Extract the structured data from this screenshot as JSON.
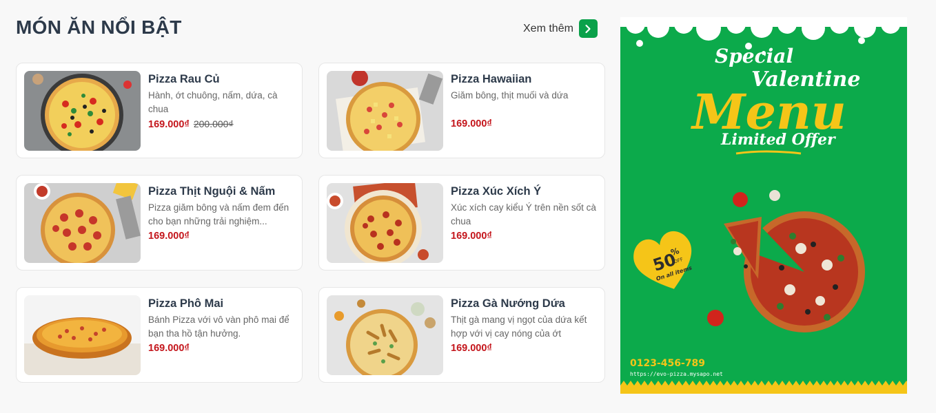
{
  "section": {
    "title": "MÓN ĂN NỔI BẬT",
    "see_more": "Xem thêm"
  },
  "colors": {
    "accent_green": "#0aa14a",
    "price_red": "#c4161c",
    "banner_green": "#0caa4b",
    "banner_yellow": "#f5c518"
  },
  "products": [
    {
      "name": "Pizza Rau Củ",
      "desc": "Hành, ớt chuông, nấm, dứa, cà chua",
      "price": "169.000₫",
      "old_price": "200.000₫"
    },
    {
      "name": "Pizza Hawaiian",
      "desc": "Giăm bông, thịt muối và dứa",
      "price": "169.000₫",
      "old_price": ""
    },
    {
      "name": "Pizza Thịt Nguội & Nấm",
      "desc": "Pizza giăm bông và nấm đem đến cho bạn những trải nghiệm...",
      "price": "169.000₫",
      "old_price": ""
    },
    {
      "name": "Pizza Xúc Xích Ý",
      "desc": "Xúc xích cay kiểu Ý trên nền sốt cà chua",
      "price": "169.000₫",
      "old_price": ""
    },
    {
      "name": "Pizza Phô Mai",
      "desc": "Bánh Pizza với vô vàn phô mai để bạn tha hồ tận hưởng.",
      "price": "169.000₫",
      "old_price": ""
    },
    {
      "name": "Pizza Gà Nướng Dứa",
      "desc": "Thịt gà mang vị ngọt của dứa kết hợp với vị cay nóng của ớt",
      "price": "169.000₫",
      "old_price": ""
    }
  ],
  "banner": {
    "line1": "Special",
    "line2": "Valentine",
    "line3": "Menu",
    "line4": "Limited Offer",
    "discount": "50",
    "discount_unit": "%",
    "discount_off": "OFF",
    "discount_note": "On all items",
    "phone": "0123-456-789",
    "url": "https://evo-pizza.mysapo.net"
  }
}
